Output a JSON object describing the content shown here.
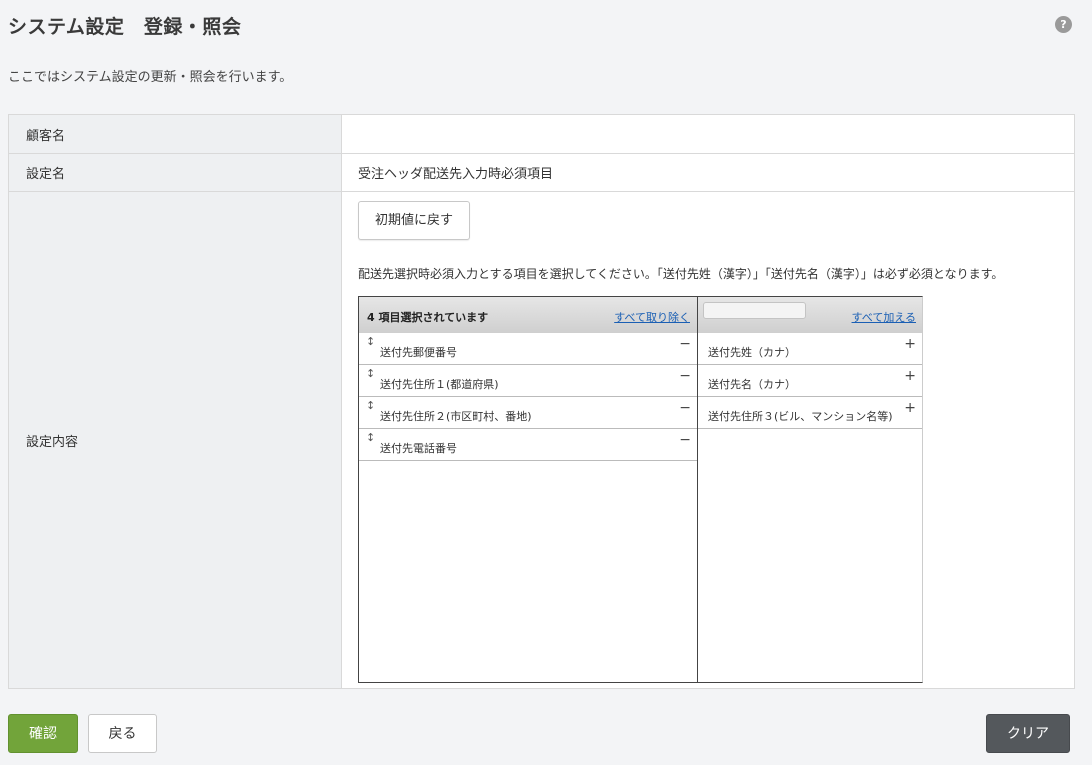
{
  "header": {
    "title": "システム設定　登録・照会",
    "help_symbol": "?",
    "description": "ここではシステム設定の更新・照会を行います。"
  },
  "form": {
    "customer_label": "顧客名",
    "customer_value": "",
    "setting_name_label": "設定名",
    "setting_name_value": "受注ヘッダ配送先入力時必須項目",
    "content_label": "設定内容",
    "reset_button": "初期値に戻す",
    "instruction": "配送先選択時必須入力とする項目を選択してください。「送付先姓（漢字）」「送付先名（漢字）」は必ず必須となります。"
  },
  "selected_list": {
    "count_text": "4 項目選択されています",
    "remove_all_link": "すべて取り除く",
    "items": [
      {
        "label": "送付先郵便番号",
        "action": "−"
      },
      {
        "label": "送付先住所１(都道府県)",
        "action": "−"
      },
      {
        "label": "送付先住所２(市区町村、番地)",
        "action": "−"
      },
      {
        "label": "送付先電話番号",
        "action": "−"
      }
    ],
    "drag_symbol": "↕"
  },
  "available_list": {
    "filter_placeholder": "",
    "filter_value": "",
    "add_all_link": "すべて加える",
    "items": [
      {
        "label": "送付先姓（カナ）",
        "action": "+"
      },
      {
        "label": "送付先名（カナ）",
        "action": "+"
      },
      {
        "label": "送付先住所３(ビル、マンション名等)",
        "action": "+"
      }
    ]
  },
  "footer": {
    "confirm_button": "確認",
    "back_button": "戻る",
    "clear_button": "クリア"
  },
  "colors": {
    "confirm": "#72a43a",
    "clear": "#54585c",
    "link": "#1a5fb4"
  }
}
